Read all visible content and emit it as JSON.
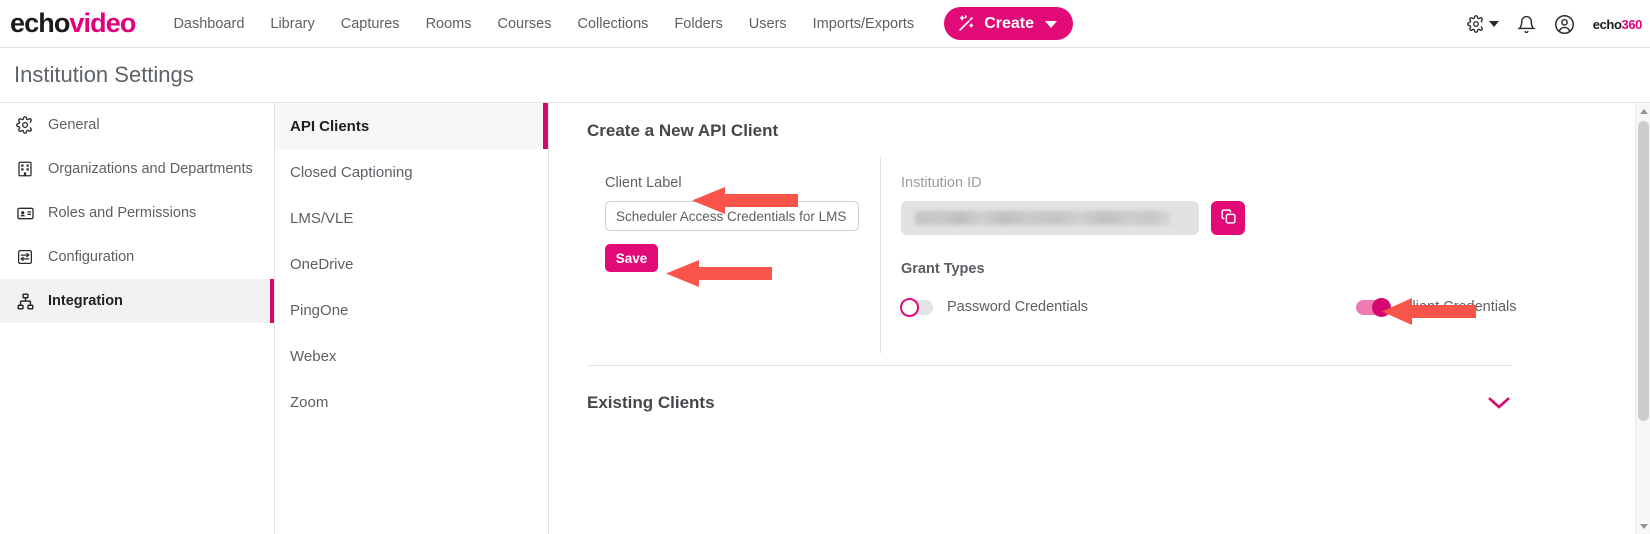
{
  "brand": {
    "logo_part1": "echo",
    "logo_part2": "video",
    "mark_part1": "echo",
    "mark_part2": "360",
    "accent_pink": "#e10a77",
    "accent_pink_dark": "#d4086f",
    "arrow_red": "#f8544a"
  },
  "topnav": {
    "links": [
      {
        "label": "Dashboard"
      },
      {
        "label": "Library"
      },
      {
        "label": "Captures"
      },
      {
        "label": "Rooms"
      },
      {
        "label": "Courses"
      },
      {
        "label": "Collections"
      },
      {
        "label": "Folders"
      },
      {
        "label": "Users"
      },
      {
        "label": "Imports/Exports"
      }
    ],
    "create_label": "Create",
    "icons": [
      {
        "name": "gear-icon"
      },
      {
        "name": "chevron-down-icon"
      },
      {
        "name": "bell-icon"
      },
      {
        "name": "user-avatar-icon"
      }
    ]
  },
  "page": {
    "title": "Institution Settings"
  },
  "sidebar": {
    "items": [
      {
        "label": "General",
        "icon": "gear-icon",
        "active": false
      },
      {
        "label": "Organizations and Departments",
        "icon": "building-icon",
        "active": false
      },
      {
        "label": "Roles and Permissions",
        "icon": "id-card-icon",
        "active": false
      },
      {
        "label": "Configuration",
        "icon": "sliders-icon",
        "active": false
      },
      {
        "label": "Integration",
        "icon": "sitemap-icon",
        "active": true
      }
    ]
  },
  "submenu": {
    "items": [
      {
        "label": "API Clients",
        "active": true
      },
      {
        "label": "Closed Captioning",
        "active": false
      },
      {
        "label": "LMS/VLE",
        "active": false
      },
      {
        "label": "OneDrive",
        "active": false
      },
      {
        "label": "PingOne",
        "active": false
      },
      {
        "label": "Webex",
        "active": false
      },
      {
        "label": "Zoom",
        "active": false
      }
    ]
  },
  "main": {
    "heading": "Create a New API Client",
    "client_label": {
      "label": "Client Label",
      "value": "Scheduler Access Credentials for LMS",
      "placeholder": "Scheduler Access Credentials for LMS"
    },
    "save_label": "Save",
    "institution_id": {
      "label": "Institution ID",
      "value": "",
      "redacted": true,
      "copy_icon": "copy-icon"
    },
    "grant_types": {
      "label": "Grant Types",
      "toggles": [
        {
          "label": "Password Credentials",
          "state": "off"
        },
        {
          "label": "Client Credentials",
          "state": "on"
        }
      ]
    },
    "existing_clients": {
      "title": "Existing Clients",
      "expand_icon": "chevron-down-icon"
    }
  },
  "annotations": {
    "arrows": [
      {
        "name": "arrow-to-client-label",
        "points_to": "Client Label"
      },
      {
        "name": "arrow-to-save-button",
        "points_to": "Save"
      },
      {
        "name": "arrow-to-client-credentials",
        "points_to": "Client Credentials"
      }
    ]
  },
  "scrollbar": {
    "up_icon": "triangle-up-icon",
    "down_icon": "triangle-down-icon"
  }
}
